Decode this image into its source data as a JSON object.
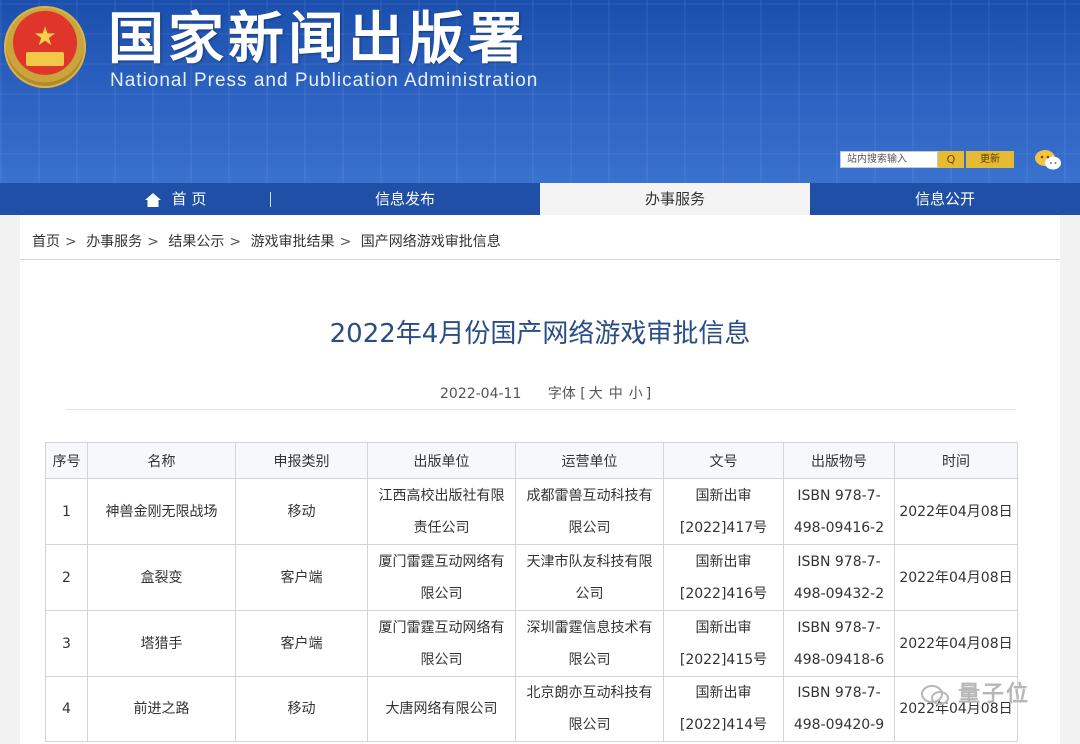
{
  "header": {
    "title": "国家新闻出版署",
    "subtitle": "National Press and Publication Administration",
    "search_placeholder": "站内搜索输入",
    "search_button": "Q",
    "advanced_label": "更新",
    "colors": {
      "banner": "#2d63c2",
      "nav": "#1f4fa6",
      "accent": "#e6ba34"
    }
  },
  "nav": {
    "home": "首 页",
    "info_release": "信息发布",
    "services": "办事服务",
    "open_info": "信息公开"
  },
  "breadcrumb": [
    "首页",
    "办事服务",
    "结果公示",
    "游戏审批结果",
    "国产网络游戏审批信息"
  ],
  "article": {
    "title": "2022年4月份国产网络游戏审批信息",
    "date": "2022-04-11",
    "font_label": "字体",
    "font_sizes": [
      "大",
      "中",
      "小"
    ]
  },
  "table": {
    "headers": [
      "序号",
      "名称",
      "申报类别",
      "出版单位",
      "运营单位",
      "文号",
      "出版物号",
      "时间"
    ],
    "rows": [
      {
        "no": "1",
        "name": "神兽金刚无限战场",
        "category": "移动",
        "publisher_l1": "江西高校出版社有限",
        "publisher_l2": "责任公司",
        "operator_l1": "成都雷兽互动科技有",
        "operator_l2": "限公司",
        "doc_l1": "国新出审",
        "doc_l2": "[2022]417号",
        "isbn_l1": "ISBN 978-7-",
        "isbn_l2": "498-09416-2",
        "date": "2022年04月08日"
      },
      {
        "no": "2",
        "name": "盒裂变",
        "category": "客户端",
        "publisher_l1": "厦门雷霆互动网络有",
        "publisher_l2": "限公司",
        "operator_l1": "天津市队友科技有限",
        "operator_l2": "公司",
        "doc_l1": "国新出审",
        "doc_l2": "[2022]416号",
        "isbn_l1": "ISBN 978-7-",
        "isbn_l2": "498-09432-2",
        "date": "2022年04月08日"
      },
      {
        "no": "3",
        "name": "塔猎手",
        "category": "客户端",
        "publisher_l1": "厦门雷霆互动网络有",
        "publisher_l2": "限公司",
        "operator_l1": "深圳雷霆信息技术有",
        "operator_l2": "限公司",
        "doc_l1": "国新出审",
        "doc_l2": "[2022]415号",
        "isbn_l1": "ISBN 978-7-",
        "isbn_l2": "498-09418-6",
        "date": "2022年04月08日"
      },
      {
        "no": "4",
        "name": "前进之路",
        "category": "移动",
        "publisher_l1": "大唐网络有限公司",
        "publisher_l2": "",
        "operator_l1": "北京朗亦互动科技有",
        "operator_l2": "限公司",
        "doc_l1": "国新出审",
        "doc_l2": "[2022]414号",
        "isbn_l1": "ISBN 978-7-",
        "isbn_l2": "498-09420-9",
        "date": "2022年04月08日"
      }
    ]
  },
  "watermark": "量子位"
}
